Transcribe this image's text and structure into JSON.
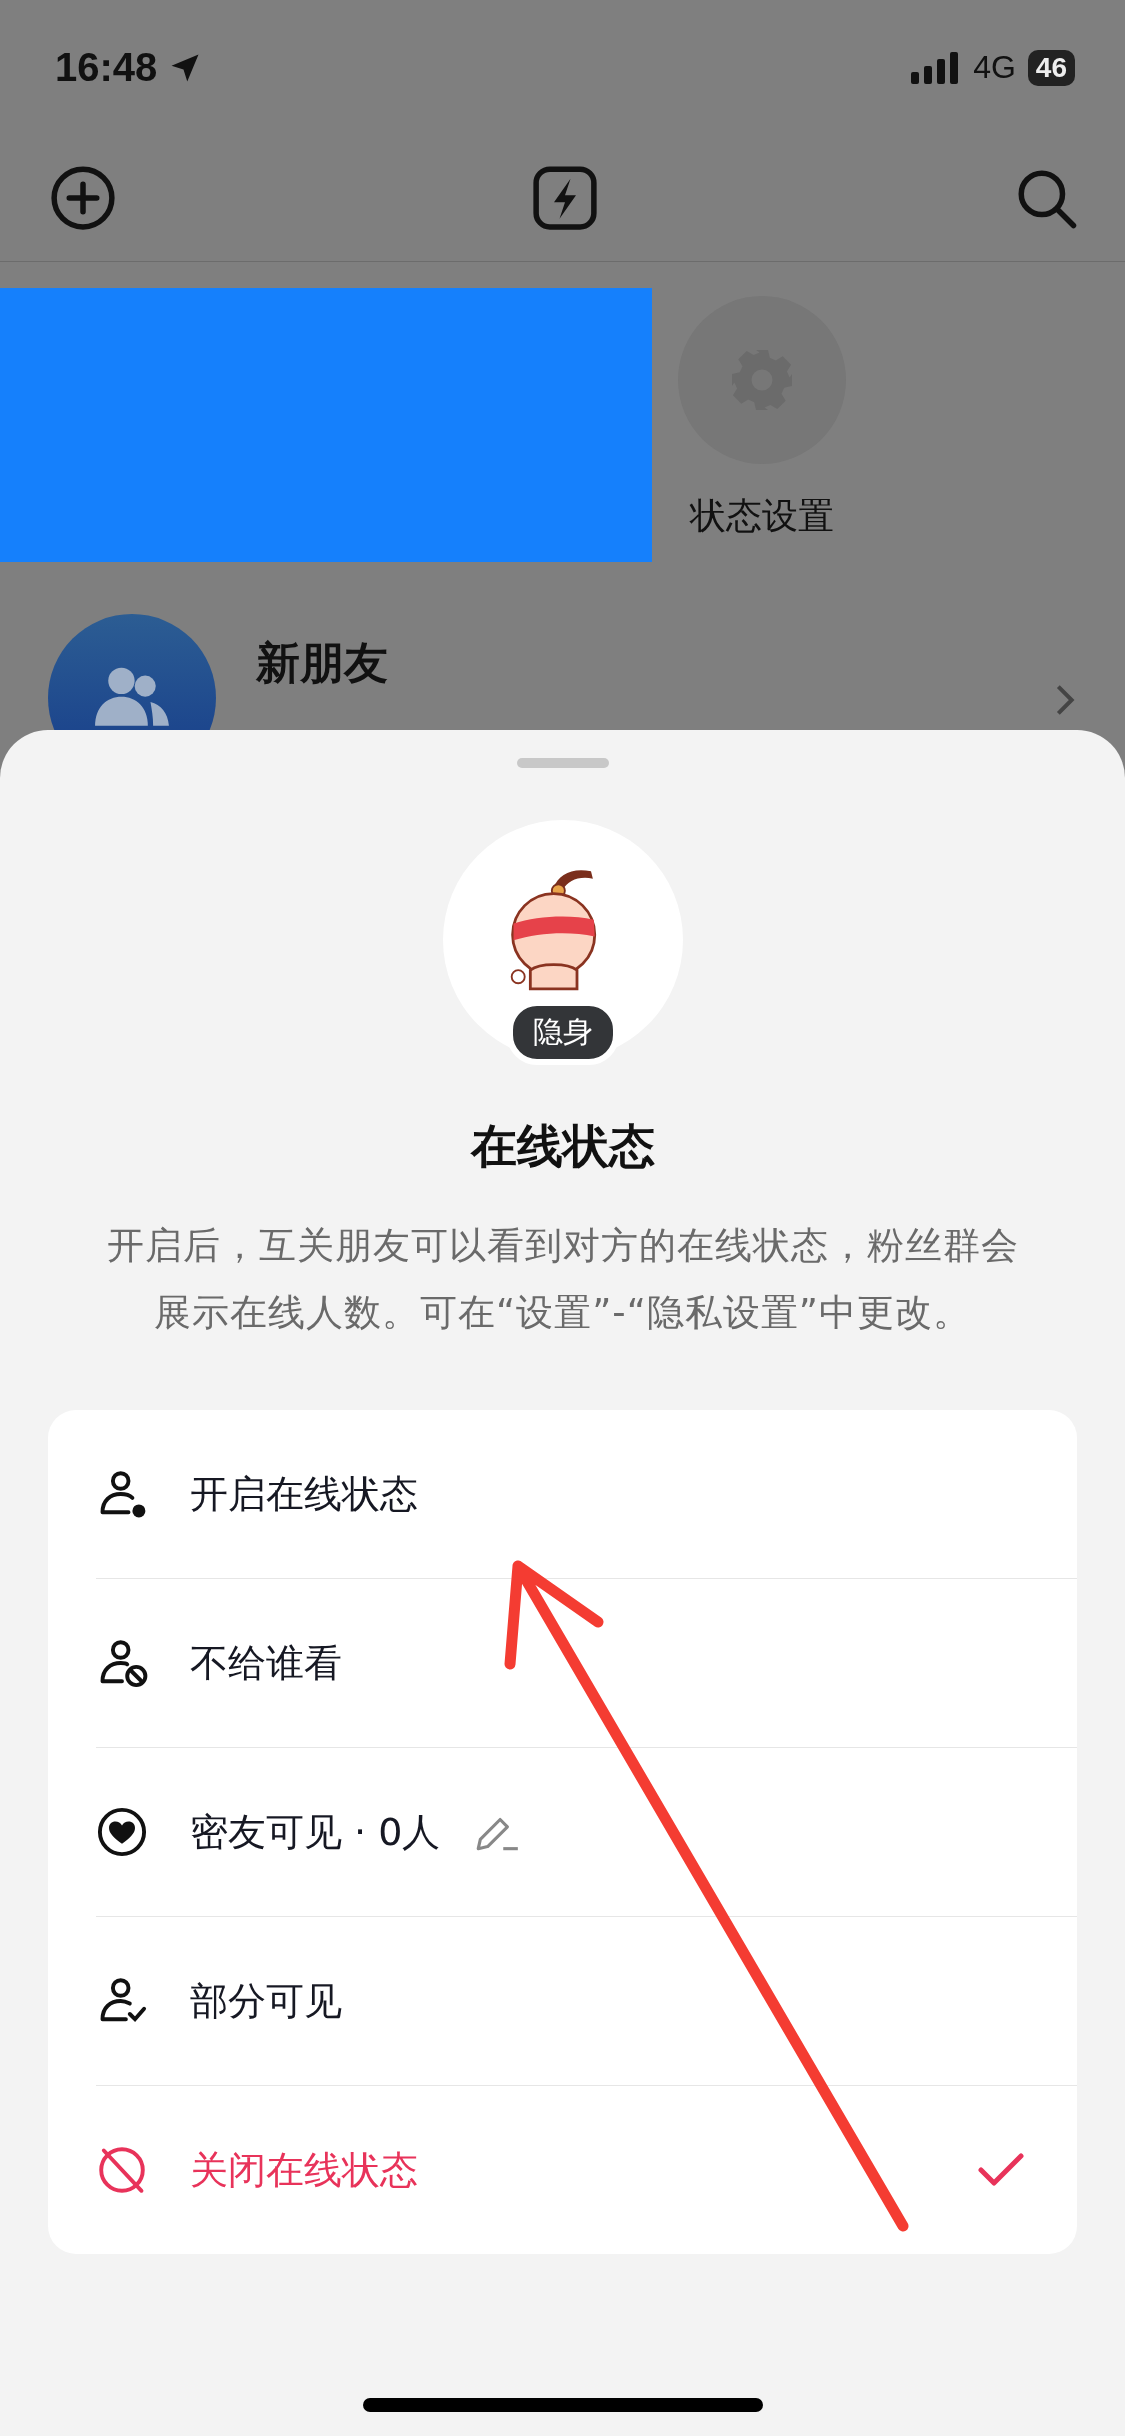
{
  "status_bar": {
    "time": "16:48",
    "network": "4G",
    "battery": "46"
  },
  "status_settings": {
    "label": "状态设置"
  },
  "contacts": [
    {
      "name": "新朋友"
    }
  ],
  "sheet": {
    "badge": "隐身",
    "title": "在线状态",
    "description": "开启后，互关朋友可以看到对方的在线状态，粉丝群会展示在线人数。可在“设置”-“隐私设置”中更改。",
    "options": [
      {
        "kind": "online",
        "label": "开启在线状态",
        "selected": false
      },
      {
        "kind": "hidden",
        "label": "不给谁看",
        "selected": false
      },
      {
        "kind": "close-friends",
        "label": "密友可见 · 0人",
        "selected": false,
        "editable": true
      },
      {
        "kind": "partial",
        "label": "部分可见",
        "selected": false
      },
      {
        "kind": "offline",
        "label": "关闭在线状态",
        "selected": true
      }
    ]
  }
}
